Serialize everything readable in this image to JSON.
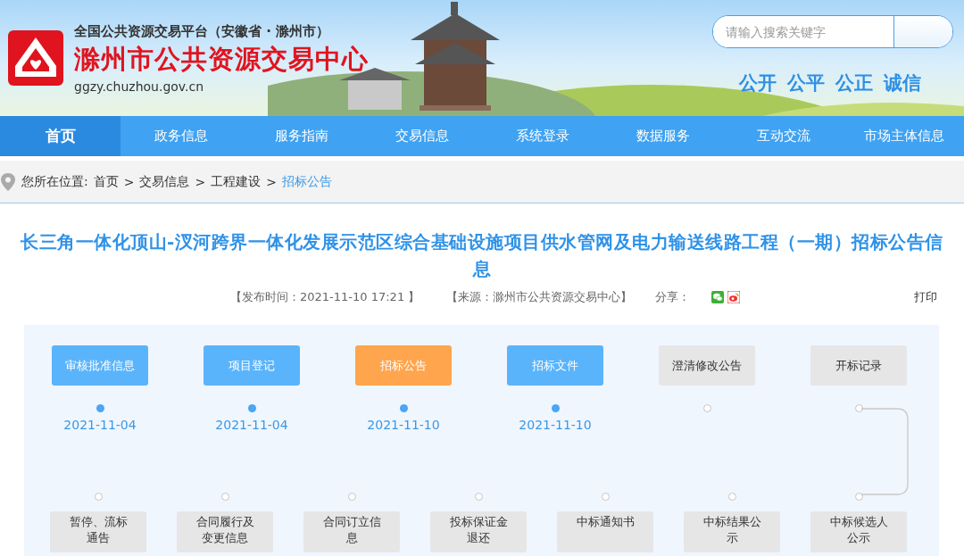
{
  "header": {
    "platform": "全国公共资源交易平台（安徽省 · 滁州市）",
    "site_name": "滁州市公共资源交易中心",
    "domain": "ggzy.chuzhou.gov.cn",
    "search": {
      "placeholder": "请输入搜索关键字"
    },
    "slogans": [
      "公开",
      "公平",
      "公正",
      "诚信"
    ]
  },
  "nav": [
    {
      "label": "首页",
      "selected": true
    },
    {
      "label": "政务信息",
      "selected": false
    },
    {
      "label": "服务指南",
      "selected": false
    },
    {
      "label": "交易信息",
      "selected": false
    },
    {
      "label": "系统登录",
      "selected": false
    },
    {
      "label": "数据服务",
      "selected": false
    },
    {
      "label": "互动交流",
      "selected": false
    },
    {
      "label": "市场主体信息",
      "selected": false
    }
  ],
  "breadcrumb": {
    "prefix": "您所在位置:",
    "items": [
      {
        "label": "首页",
        "selected": false
      },
      {
        "label": "交易信息",
        "selected": false
      },
      {
        "label": "工程建设",
        "selected": false
      },
      {
        "label": "招标公告",
        "selected": true
      }
    ],
    "separator": ">"
  },
  "article": {
    "title": "长三角一体化顶山-汊河跨界一体化发展示范区综合基础设施项目供水管网及电力输送线路工程（一期）招标公告信息",
    "published": "【发布时间：2021-11-10 17:21 】",
    "source": "【来源：滁州市公共资源交易中心】",
    "share_label": "分享：",
    "print": "打印"
  },
  "process": {
    "top": [
      {
        "label": "审核批准信息",
        "kind": "done",
        "date": "2021-11-04"
      },
      {
        "label": "项目登记",
        "kind": "done",
        "date": "2021-11-04"
      },
      {
        "label": "招标公告",
        "kind": "current",
        "date": "2021-11-10"
      },
      {
        "label": "招标文件",
        "kind": "done",
        "date": "2021-11-10"
      },
      {
        "label": "澄清修改公告",
        "kind": "pending"
      },
      {
        "label": "开标记录",
        "kind": "pending"
      }
    ],
    "bottom": [
      {
        "label": "暂停、流标通告",
        "kind": "pending"
      },
      {
        "label": "合同履行及变更信息",
        "kind": "pending"
      },
      {
        "label": "合同订立信息",
        "kind": "pending"
      },
      {
        "label": "投标保证金退还",
        "kind": "pending"
      },
      {
        "label": "中标通知书",
        "kind": "pending"
      },
      {
        "label": "中标结果公示",
        "kind": "pending"
      },
      {
        "label": "中标候选人公示",
        "kind": "pending"
      }
    ]
  }
}
